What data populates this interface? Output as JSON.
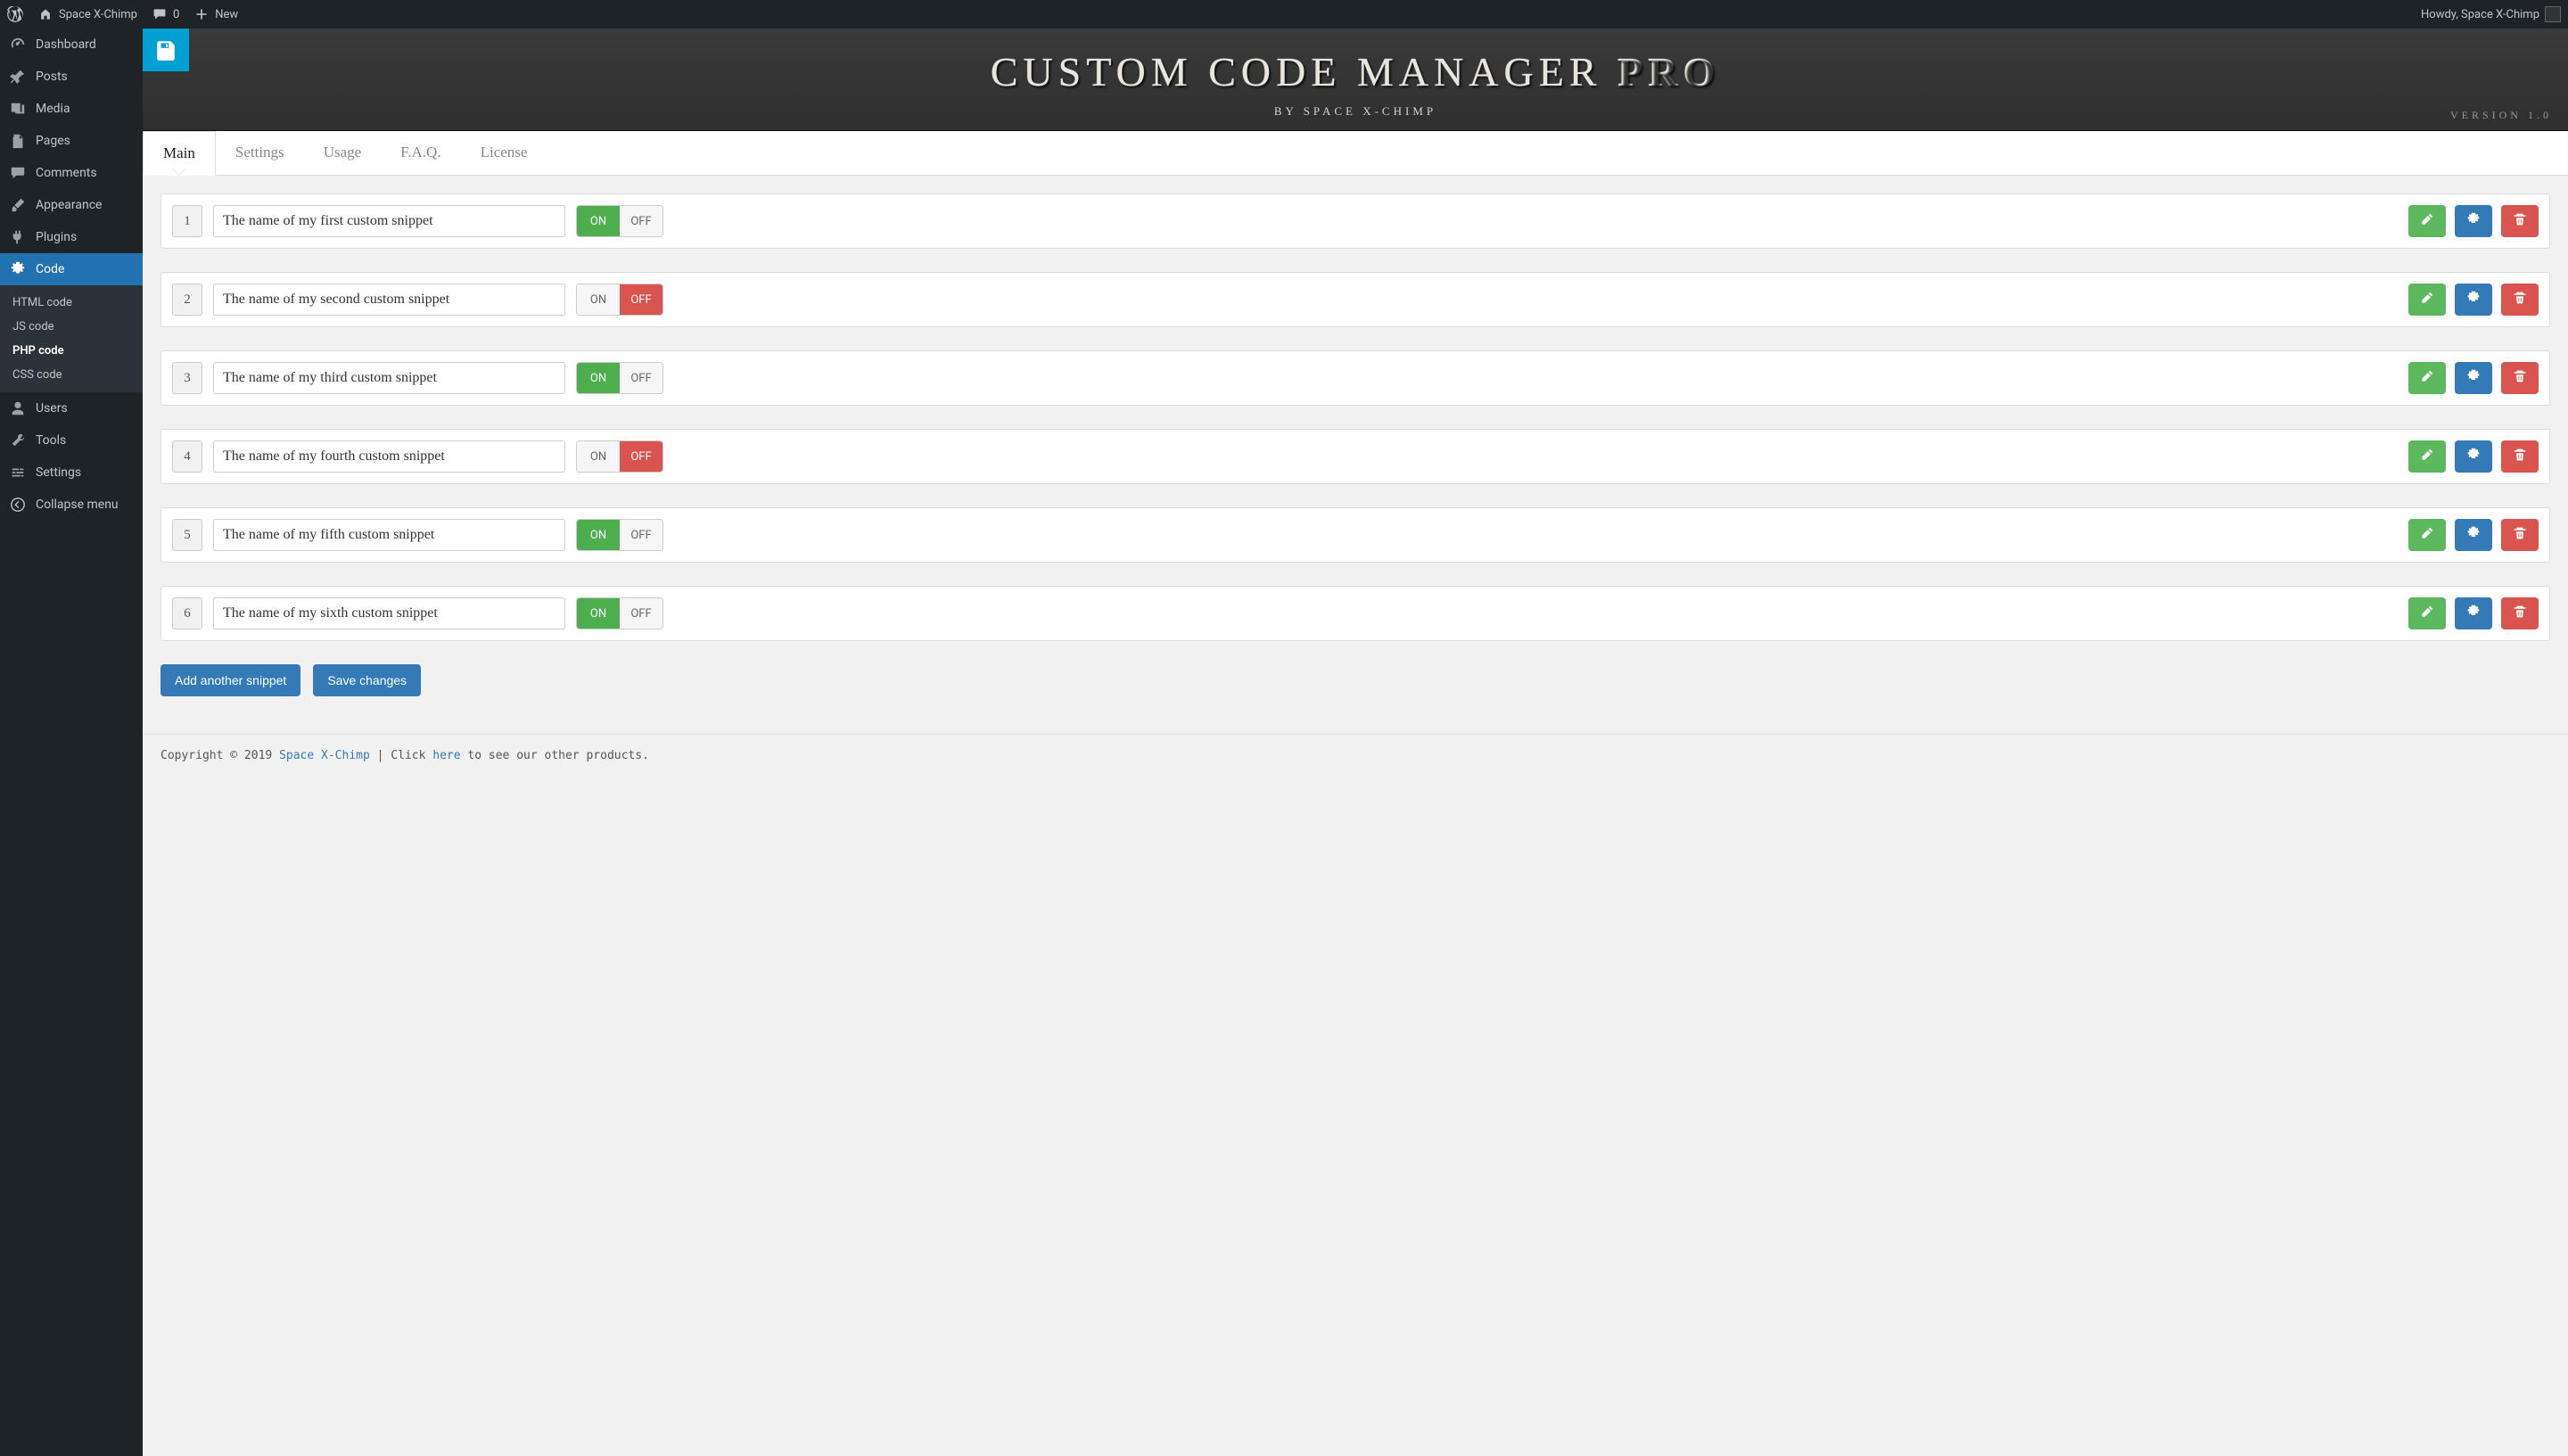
{
  "adminbar": {
    "site_name": "Space X-Chimp",
    "comments_count": "0",
    "new_label": "New",
    "howdy": "Howdy, Space X-Chimp"
  },
  "sidebar": {
    "items": [
      {
        "label": "Dashboard",
        "icon": "dash"
      },
      {
        "label": "Posts",
        "icon": "pin"
      },
      {
        "label": "Media",
        "icon": "media"
      },
      {
        "label": "Pages",
        "icon": "page"
      },
      {
        "label": "Comments",
        "icon": "comment"
      },
      {
        "label": "Appearance",
        "icon": "brush"
      },
      {
        "label": "Plugins",
        "icon": "plug"
      },
      {
        "label": "Code",
        "icon": "gear",
        "active": true
      },
      {
        "label": "Users",
        "icon": "user"
      },
      {
        "label": "Tools",
        "icon": "wrench"
      },
      {
        "label": "Settings",
        "icon": "sliders"
      },
      {
        "label": "Collapse menu",
        "icon": "collapse"
      }
    ],
    "submenu": [
      {
        "label": "HTML code"
      },
      {
        "label": "JS code"
      },
      {
        "label": "PHP code",
        "active": true
      },
      {
        "label": "CSS code"
      }
    ]
  },
  "header": {
    "title_main": "CUSTOM CODE MANAGER",
    "title_suffix": "PRO",
    "subtitle": "BY SPACE X-CHIMP",
    "version": "VERSION 1.0"
  },
  "tabs": [
    {
      "label": "Main",
      "active": true
    },
    {
      "label": "Settings"
    },
    {
      "label": "Usage"
    },
    {
      "label": "F.A.Q."
    },
    {
      "label": "License"
    }
  ],
  "toggle": {
    "on": "ON",
    "off": "OFF"
  },
  "snippets": [
    {
      "num": "1",
      "name": "The name of my first custom snippet",
      "state": "on"
    },
    {
      "num": "2",
      "name": "The name of my second custom snippet",
      "state": "off"
    },
    {
      "num": "3",
      "name": "The name of my third custom snippet",
      "state": "on"
    },
    {
      "num": "4",
      "name": "The name of my fourth custom snippet",
      "state": "off"
    },
    {
      "num": "5",
      "name": "The name of my fifth custom snippet",
      "state": "on"
    },
    {
      "num": "6",
      "name": "The name of my sixth custom snippet",
      "state": "on"
    }
  ],
  "buttons": {
    "add": "Add another snippet",
    "save": "Save changes"
  },
  "footer": {
    "pre": "Copyright © 2019 ",
    "brand": "Space X-Chimp",
    "mid": " | Click ",
    "link": "here",
    "post": " to see our other products."
  }
}
